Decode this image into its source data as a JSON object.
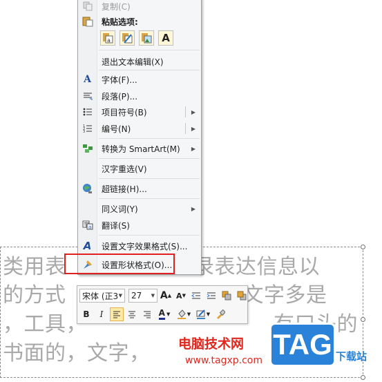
{
  "menu": {
    "copy": "复制(C)",
    "paste_options": "粘贴选项:",
    "paste_buttons": [
      "A"
    ],
    "items": [
      {
        "label": "退出文本编辑(X)"
      },
      {
        "label": "字体(F)..."
      },
      {
        "label": "段落(P)..."
      },
      {
        "label": "项目符号(B)"
      },
      {
        "label": "编号(N)"
      },
      {
        "label": "转换为 SmartArt(M)"
      },
      {
        "label": "汉字重选(V)"
      },
      {
        "label": "超链接(H)..."
      },
      {
        "label": "同义词(Y)"
      },
      {
        "label": "翻译(S)"
      },
      {
        "label": "设置文字效果格式(S)..."
      },
      {
        "label": "设置形状格式(O)..."
      }
    ]
  },
  "toolbar": {
    "font_name": "宋体 (正3",
    "font_size": "27",
    "grow_font": "A",
    "shrink_font": "A",
    "bold": "B",
    "italic": "I",
    "font_color": "A"
  },
  "slide_text": {
    "line1": "类用表",
    "line1_end": "记录表达信息以",
    "line2": "的方式",
    "line2_end": "文字多是",
    "line3": "，工具，",
    "line3_end": "有口头的",
    "line4": "书面的，文字，"
  },
  "watermark": {
    "site_name": "电脑技术网",
    "url": "www.tagxp.com",
    "logo": "TAG",
    "logo_sub": "下载站"
  },
  "colors": {
    "highlight": "#e02020",
    "watermark_red": "#e0281e",
    "logo_blue": "#2a83d8"
  }
}
